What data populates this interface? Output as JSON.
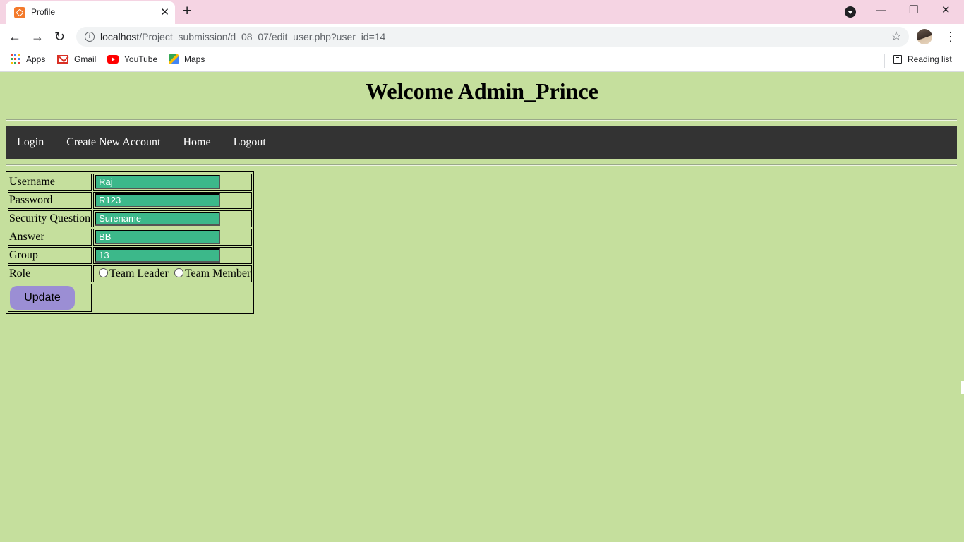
{
  "browser": {
    "tab_title": "Profile",
    "tab_close": "✕",
    "new_tab": "+",
    "url_host": "localhost",
    "url_path": "/Project_submission/d_08_07/edit_user.php?user_id=14",
    "bookmarks": [
      "Apps",
      "Gmail",
      "YouTube",
      "Maps"
    ],
    "reading_list": "Reading list",
    "window_controls": {
      "minimize": "—",
      "restore": "❐",
      "close": "✕"
    }
  },
  "page": {
    "heading": "Welcome Admin_Prince",
    "nav": [
      "Login",
      "Create New Account",
      "Home",
      "Logout"
    ],
    "form": {
      "username_label": "Username",
      "username_value": "Raj",
      "password_label": "Password",
      "password_value": "R123",
      "security_label": "Security Question",
      "security_value": "Surename",
      "answer_label": "Answer",
      "answer_value": "BB",
      "group_label": "Group",
      "group_value": "13",
      "role_label": "Role",
      "role_options": [
        "Team Leader",
        "Team Member"
      ],
      "update_label": "Update"
    }
  },
  "colors": {
    "page_background": "#c5df9d",
    "navbar_background": "#333333",
    "field_background": "#3cb88a",
    "button_background": "#9b8ed4",
    "tab_strip": "#f5d4e3"
  }
}
